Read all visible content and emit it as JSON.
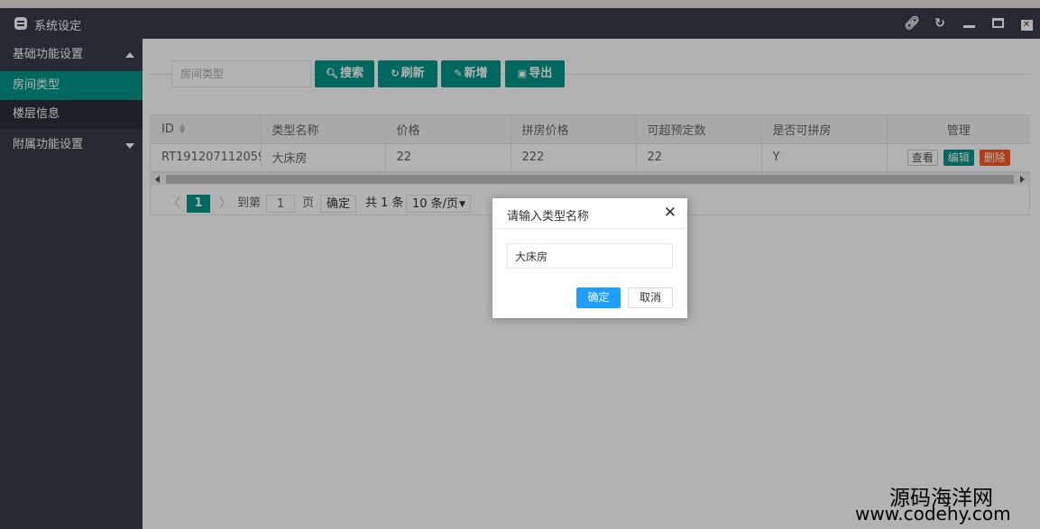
{
  "window": {
    "title": "系统设定"
  },
  "sidebar": {
    "groups": [
      {
        "label": "基础功能设置",
        "expanded": true
      },
      {
        "label": "附属功能设置",
        "expanded": false
      }
    ],
    "items": [
      {
        "label": "房间类型",
        "active": true
      },
      {
        "label": "楼层信息",
        "active": false
      }
    ]
  },
  "toolbar": {
    "search_placeholder": "房间类型",
    "search_label": "搜索",
    "refresh_label": "刷新",
    "add_label": "新增",
    "export_label": "导出"
  },
  "table": {
    "headers": [
      "ID",
      "类型名称",
      "价格",
      "拼房价格",
      "可超预定数",
      "是否可拼房",
      "管理"
    ],
    "rows": [
      {
        "id": "RT191207112059",
        "name": "大床房",
        "price": "22",
        "share_price": "222",
        "overbook": "22",
        "shareable": "Y"
      }
    ],
    "actions": {
      "view": "查看",
      "edit": "编辑",
      "delete": "删除"
    }
  },
  "pagination": {
    "current": "1",
    "goto_label": "到第",
    "goto_value": "1",
    "page_suffix": "页",
    "confirm_label": "确定",
    "total_label": "共 1 条",
    "page_size": "10 条/页"
  },
  "dialog": {
    "title": "请输入类型名称",
    "input_value": "大床房",
    "ok_label": "确定",
    "cancel_label": "取消"
  },
  "watermark": {
    "cn": "源码海洋网",
    "url": "www.codehy.com"
  },
  "colors": {
    "titlebar": "#393d49",
    "accent": "#009688",
    "primary_button": "#1e9fff",
    "danger": "#ff5722"
  }
}
